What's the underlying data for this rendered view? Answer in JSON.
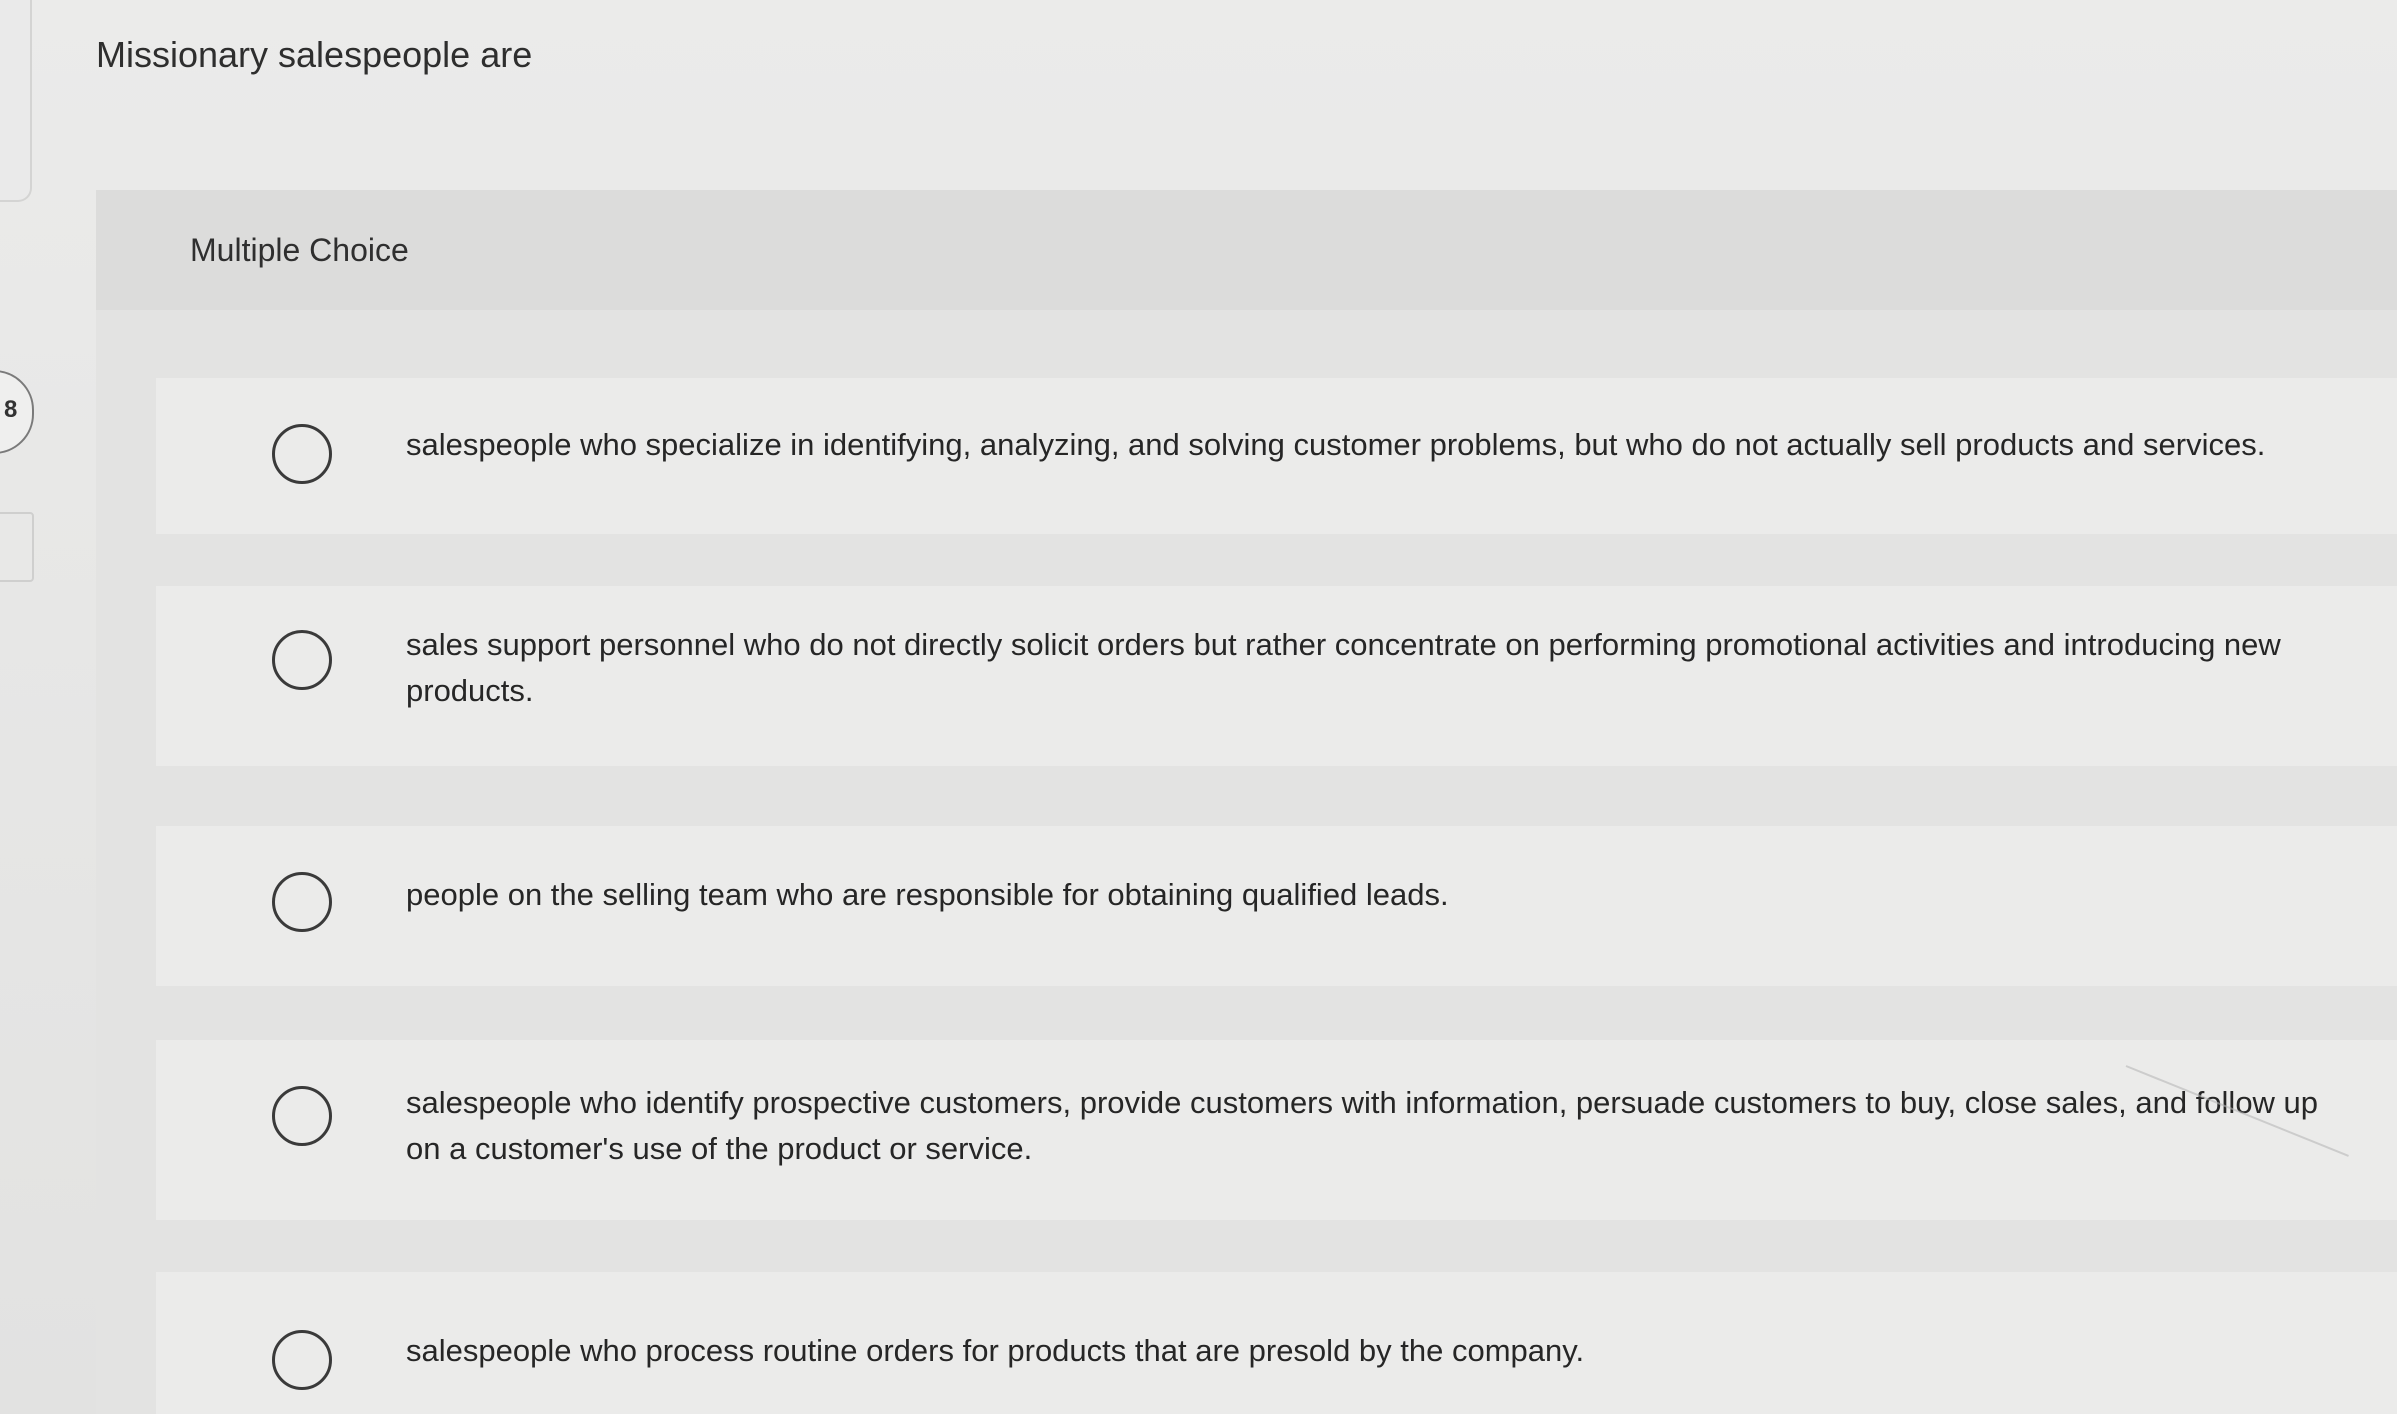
{
  "side": {
    "question_number": "8"
  },
  "question": {
    "prompt": "Missionary salespeople are"
  },
  "panel": {
    "type_label": "Multiple Choice"
  },
  "choices": [
    {
      "text": "salespeople who specialize in identifying, analyzing, and solving customer problems, but who do not actually sell products and services.",
      "selected": false
    },
    {
      "text": "sales support personnel who do not directly solicit orders but rather concentrate on performing promotional activities and introducing new products.",
      "selected": false
    },
    {
      "text": "people on the selling team who are responsible for obtaining qualified leads.",
      "selected": false
    },
    {
      "text": "salespeople who identify prospective customers, provide customers with information, persuade customers to buy, close sales, and follow up on a customer's use of the product or service.",
      "selected": false
    },
    {
      "text": "salespeople who process routine orders for products that are presold by the company.",
      "selected": false
    }
  ]
}
